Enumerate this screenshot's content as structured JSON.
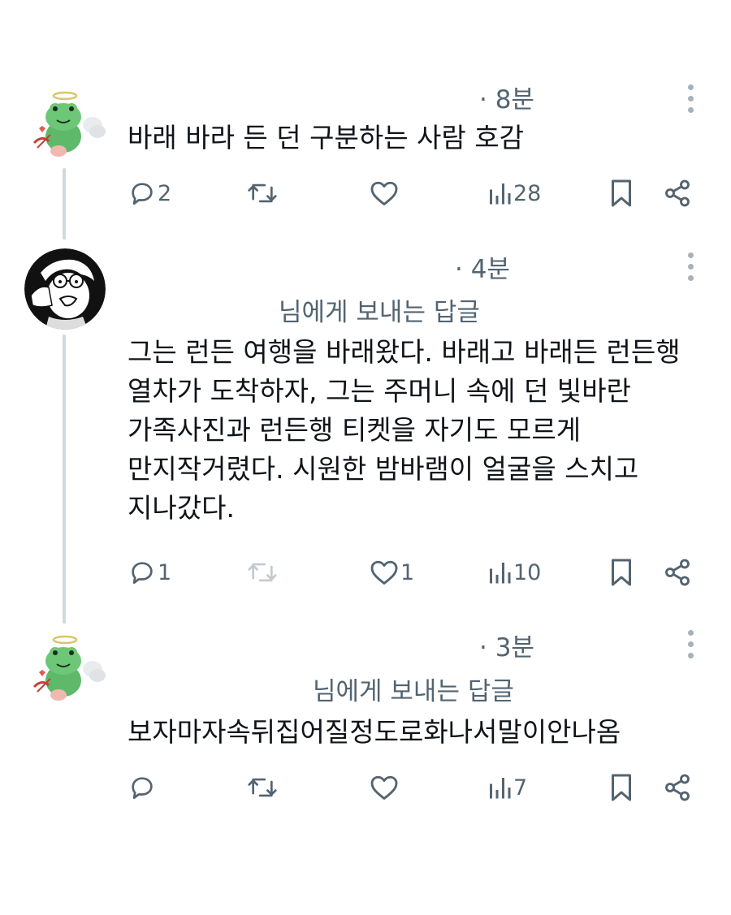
{
  "replies": [
    {
      "time": "· 8분",
      "text": "바래 바라 든 던 구분하는 사람 호감",
      "replying_to": "",
      "actions": {
        "reply": "2",
        "repost": "",
        "like": "",
        "views": "28"
      }
    },
    {
      "time": "· 4분",
      "replying_to": "님에게 보내는 답글",
      "text": "그는 런든 여행을 바래왔다. 바래고 바래든 런든행\n열차가 도착하자, 그는 주머니 속에 던 빛바란\n가족사진과 런든행 티켓을 자기도 모르게\n만지작거렸다. 시원한 밤바램이 얼굴을 스치고\n지나갔다.",
      "actions": {
        "reply": "1",
        "repost": "",
        "like": "1",
        "views": "10"
      }
    },
    {
      "time": "· 3분",
      "replying_to": "님에게 보내는 답글",
      "text": "보자마자속뒤집어질정도로화나서말이안나옴",
      "actions": {
        "reply": "",
        "repost": "",
        "like": "",
        "views": "7"
      }
    }
  ],
  "colors": {
    "muted": "#536471",
    "text": "#0f1419",
    "thread_line": "#cfd9de",
    "frog_green": "#5fb96a"
  },
  "icons": [
    "frog-angel-avatar",
    "sketch-face-avatar",
    "reply-icon",
    "repost-icon",
    "like-icon",
    "views-icon",
    "bookmark-icon",
    "share-icon",
    "more-icon"
  ]
}
